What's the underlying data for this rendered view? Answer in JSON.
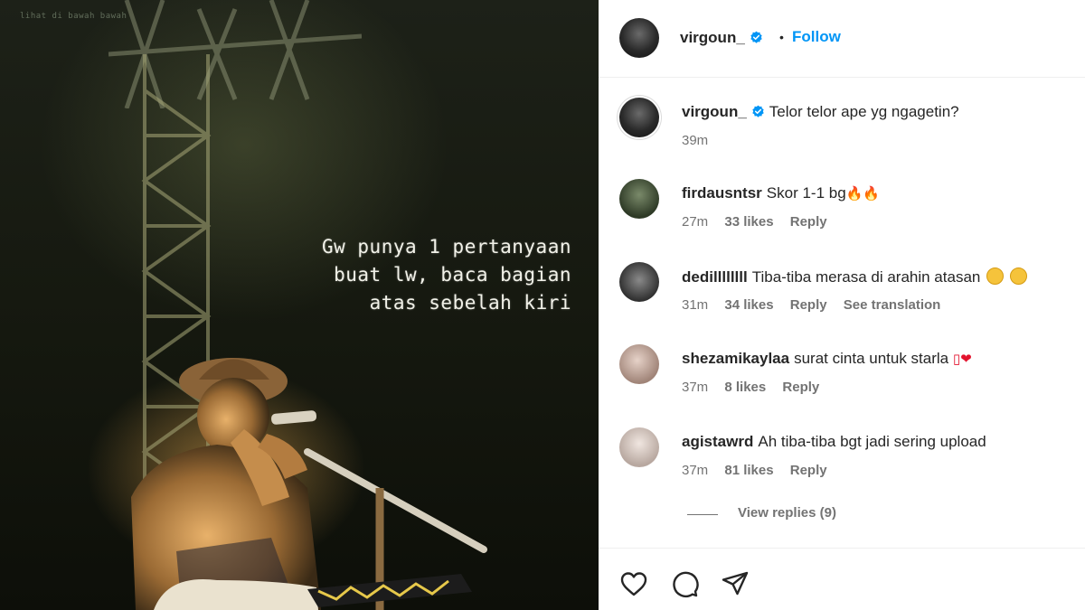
{
  "photo": {
    "watermark": "lihat di bawah bawah",
    "quote_lines": [
      "Gw punya 1 pertanyaan",
      "buat lw, baca bagian",
      "atas sebelah kiri"
    ]
  },
  "post": {
    "author": "virgoun_",
    "dot": "•",
    "follow_label": "Follow",
    "caption": "Telor telor ape yg ngagetin?",
    "caption_time": "39m"
  },
  "comments": [
    {
      "user": "firdausntsr",
      "text": "Skor 1-1 bg",
      "emoji": "🔥🔥",
      "time": "27m",
      "likes": "33 likes",
      "reply": "Reply"
    },
    {
      "user": "dedillllllll",
      "text": "Tiba-tiba merasa di arahin atasan",
      "time": "31m",
      "likes": "34 likes",
      "reply": "Reply",
      "translate": "See translation"
    },
    {
      "user": "shezamikaylaa",
      "text": "surat cinta untuk starla",
      "emoji": "▯❤",
      "time": "37m",
      "likes": "8 likes",
      "reply": "Reply"
    },
    {
      "user": "agistawrd",
      "text": "Ah tiba-tiba bgt jadi sering upload",
      "time": "37m",
      "likes": "81 likes",
      "reply": "Reply"
    }
  ],
  "view_replies": "View replies (9)",
  "icons": {
    "like": "heart-icon",
    "comment": "comment-icon",
    "share": "share-icon",
    "verified": "verified-badge-icon"
  },
  "colors": {
    "accent": "#0095f6",
    "verified": "#0095f6",
    "muted": "#737373"
  }
}
